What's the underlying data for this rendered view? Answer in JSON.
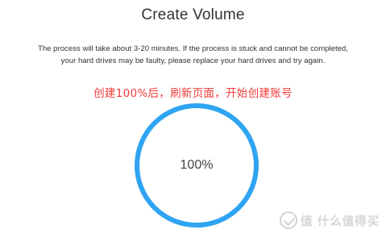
{
  "dialog": {
    "title": "Create Volume",
    "description": "The process will take about 3-20 minutes. If the process is stuck and cannot be completed, your hard drives may be faulty, please replace your hard drives and try again.",
    "annotation": "创建100%后，刷新页面，开始创建账号",
    "progress": {
      "value": 100,
      "label": "100%"
    }
  },
  "watermark": {
    "logo_icon": "smzdm-logo-icon",
    "text": "值 什么值得买"
  },
  "colors": {
    "ring": "#2ea4f3",
    "annotation": "#f13a3a",
    "text": "#333333"
  }
}
